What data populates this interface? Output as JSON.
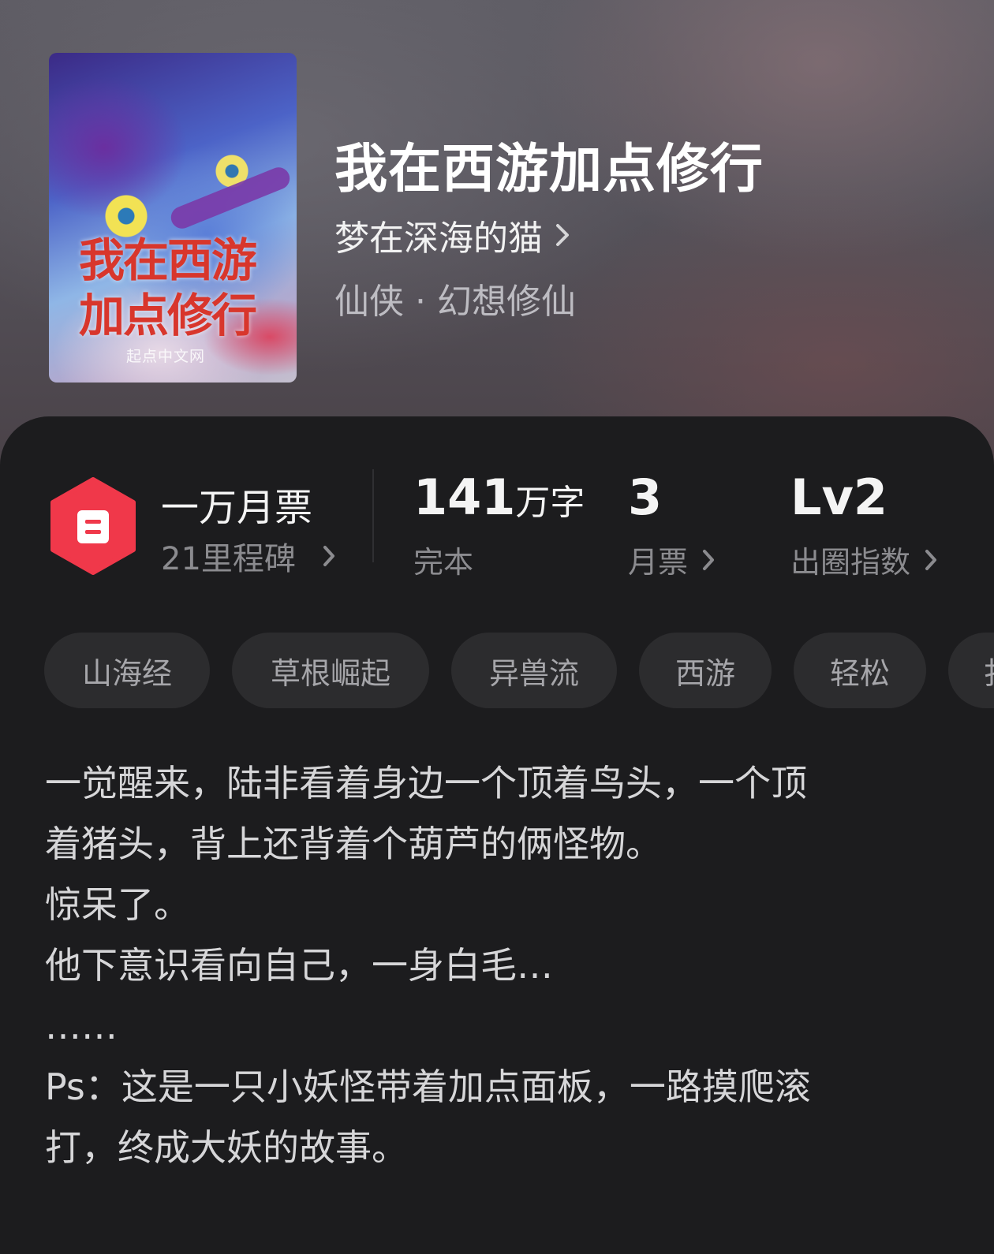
{
  "book": {
    "title": "我在西游加点修行",
    "author": "梦在深海的猫",
    "genre": "仙侠 · 幻想修仙",
    "cover": {
      "title_line1": "我在西游",
      "title_line2": "加点修行",
      "publisher": "起点中文网"
    }
  },
  "stats": {
    "tickets_title": "一万月票",
    "tickets_sub": "21里程碑",
    "words_value": "141",
    "words_unit": "万字",
    "words_sub": "完本",
    "monthly_value": "3",
    "monthly_sub": "月票",
    "index_value": "Lv2",
    "index_sub": "出圈指数"
  },
  "tags": [
    "山海经",
    "草根崛起",
    "异兽流",
    "西游",
    "轻松",
    "扌"
  ],
  "synopsis": [
    "一觉醒来，陆非看着身边一个顶着鸟头，一个顶",
    "着猪头，背上还背着个葫芦的俩怪物。",
    "惊呆了。",
    "他下意识看向自己，一身白毛…",
    "……",
    "Ps：这是一只小妖怪带着加点面板，一路摸爬滚",
    "打，终成大妖的故事。"
  ],
  "colors": {
    "accent_red": "#f0384a",
    "sheet_bg": "#1c1c1e",
    "tag_bg": "#2c2c2e"
  },
  "icons": [
    "ticket-badge-icon",
    "chevron-right-icon"
  ]
}
